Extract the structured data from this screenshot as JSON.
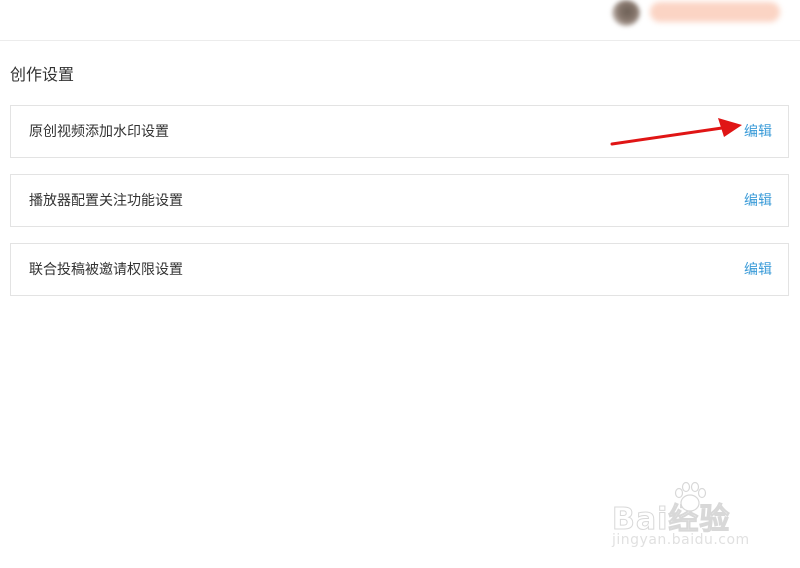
{
  "header": {
    "avatar_icon": "user-avatar-blurred",
    "username": ""
  },
  "section": {
    "title": "创作设置"
  },
  "settings": [
    {
      "label": "原创视频添加水印设置",
      "action": "编辑"
    },
    {
      "label": "播放器配置关注功能设置",
      "action": "编辑"
    },
    {
      "label": "联合投稿被邀请权限设置",
      "action": "编辑"
    }
  ],
  "colors": {
    "link": "#3a9bd8",
    "text": "#333333",
    "border": "#e3e3e3",
    "annotation": "#e01515"
  },
  "watermark": {
    "brand": "Bai经验",
    "url": "jingyan.baidu.com"
  }
}
